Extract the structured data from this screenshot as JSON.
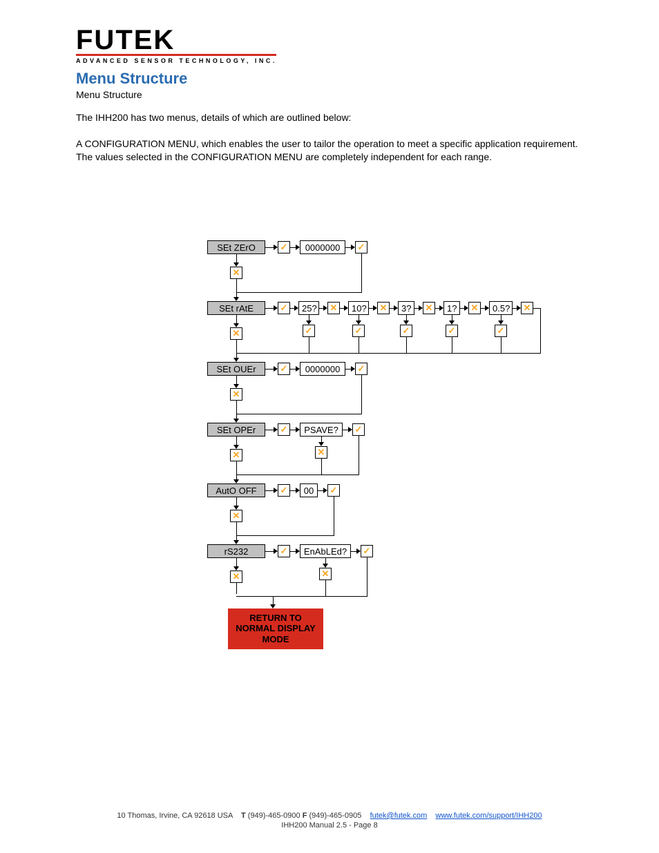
{
  "logo": {
    "main": "FUTEK",
    "sub": "ADVANCED SENSOR TECHNOLOGY, INC."
  },
  "heading": "Menu Structure",
  "subheading": "Menu Structure",
  "para1": "The IHH200 has two menus, details of which are outlined below:",
  "para2": "A CONFIGURATION MENU, which enables the user to tailor the operation to meet a specific application requirement. The values selected in the CONFIGURATION MENU are completely independent for each range.",
  "diagram": {
    "menu_items": [
      "SEt ZErO",
      "SEt rAtE",
      "SEt OUEr",
      "SEt OPEr",
      "AutO OFF",
      "rS232"
    ],
    "set_zero_val": "0000000",
    "set_rate_vals": [
      "25?",
      "10?",
      "3?",
      "1?",
      "0.5?"
    ],
    "set_ouer_val": "0000000",
    "set_oper_val": "PSAVE?",
    "auto_off_val": "00",
    "rs232_val": "EnAbLEd?",
    "return": "RETURN TO NORMAL DISPLAY MODE"
  },
  "footer": {
    "address": "10 Thomas, Irvine, CA 92618 USA",
    "t_label": "T",
    "tel": "(949)-465-0900",
    "f_label": "F",
    "fax": "(949)-465-0905",
    "email": "futek@futek.com",
    "url": "www.futek.com/support/IHH200",
    "line2": "IHH200 Manual 2.5 - Page  8"
  }
}
